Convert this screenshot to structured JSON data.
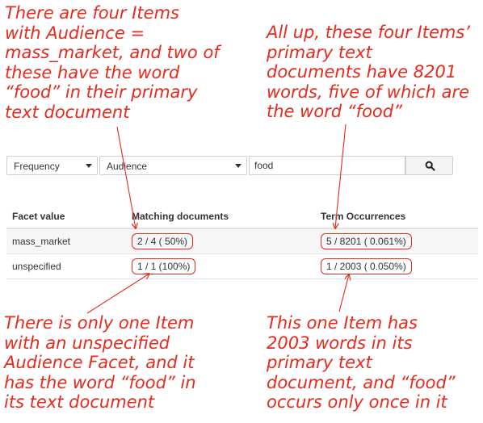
{
  "annotations": {
    "top_left": "There are four Items\nwith Audience =\nmass_market, and two of\nthese have the word\n“food” in their primary\ntext document",
    "top_right": "All up, these four Items’\nprimary text\ndocuments have 8201\nwords, five of which are\nthe word “food”",
    "bottom_left": "There is only one Item\nwith an unspecified\nAudience Facet, and it\nhas the word “food” in\nits text document",
    "bottom_right": "This one Item has\n2003 words in its\nprimary text\ndocument, and “food”\noccurs only once in it",
    "color": "#e8291c"
  },
  "toolbar": {
    "frequency_select": "Frequency",
    "facet_select": "Audience",
    "search_value": "food",
    "search_icon": "search-icon"
  },
  "table": {
    "headers": [
      "Facet value",
      "Matching documents",
      "Term Occurrences"
    ],
    "rows": [
      {
        "facet": "mass_market",
        "matching": "2 / 4 ( 50%)",
        "occurrences": "5 / 8201 ( 0.061%)"
      },
      {
        "facet": "unspecified",
        "matching": "1 / 1 (100%)",
        "occurrences": "1 / 2003 ( 0.050%)"
      }
    ]
  }
}
